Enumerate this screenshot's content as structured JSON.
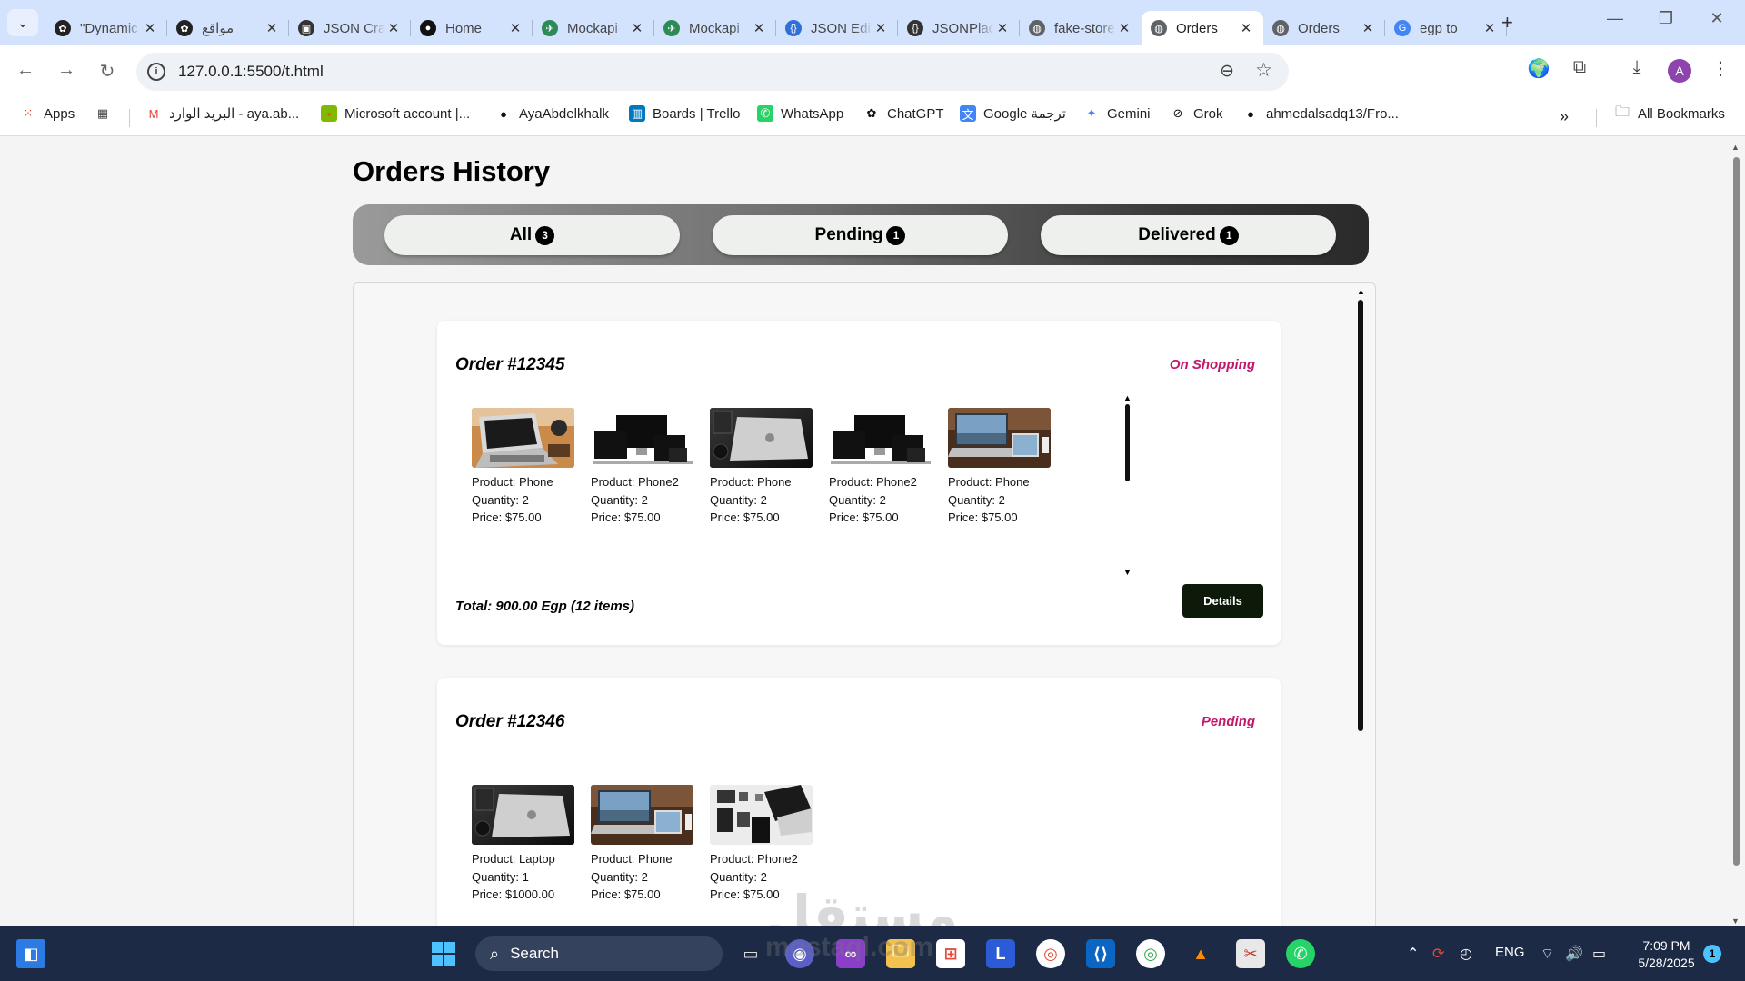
{
  "browser": {
    "tabs": [
      {
        "title": "\"Dynamic",
        "favicon": "openai-icon",
        "color": "#222222",
        "glyph": "✿"
      },
      {
        "title": "مواقع",
        "favicon": "openai-icon",
        "color": "#222222",
        "glyph": "✿"
      },
      {
        "title": "JSON Crack",
        "favicon": "json-crack-icon",
        "color": "#333333",
        "glyph": "▣"
      },
      {
        "title": "Home",
        "favicon": "github-icon",
        "color": "#111111",
        "glyph": "●"
      },
      {
        "title": "Mockapi",
        "favicon": "mockapi-icon",
        "color": "#2e8b57",
        "glyph": "✈"
      },
      {
        "title": "Mockapi",
        "favicon": "mockapi-icon",
        "color": "#2e8b57",
        "glyph": "✈"
      },
      {
        "title": "JSON Editor",
        "favicon": "json-icon",
        "color": "#2f6fd8",
        "glyph": "{}"
      },
      {
        "title": "JSONPlaceholder",
        "favicon": "jsonplaceholder-icon",
        "color": "#333333",
        "glyph": "{}"
      },
      {
        "title": "fake-store",
        "favicon": "globe-icon",
        "color": "#5f6368",
        "glyph": "◍"
      },
      {
        "title": "Orders",
        "favicon": "globe-icon",
        "color": "#5f6368",
        "glyph": "◍",
        "active": true
      },
      {
        "title": "Orders",
        "favicon": "globe-icon",
        "color": "#5f6368",
        "glyph": "◍"
      },
      {
        "title": "egp to",
        "favicon": "google-icon",
        "color": "#4285f4",
        "glyph": "G"
      }
    ],
    "url": "127.0.0.1:5500/t.html",
    "avatar_letter": "A",
    "bookmarks": [
      {
        "label": "Apps",
        "icon": "apps-grid-icon"
      },
      {
        "label": "",
        "icon": "grid-icon"
      },
      {
        "label": "البريد الوارد - aya.ab...",
        "icon": "gmail-icon"
      },
      {
        "label": "Microsoft account |...",
        "icon": "microsoft-icon"
      },
      {
        "label": "AyaAbdelkhalk",
        "icon": "github-icon"
      },
      {
        "label": "Boards | Trello",
        "icon": "trello-icon"
      },
      {
        "label": "WhatsApp",
        "icon": "whatsapp-icon"
      },
      {
        "label": "ChatGPT",
        "icon": "openai-icon"
      },
      {
        "label": "Google ترجمة",
        "icon": "google-translate-icon"
      },
      {
        "label": "Gemini",
        "icon": "gemini-icon"
      },
      {
        "label": "Grok",
        "icon": "grok-icon"
      },
      {
        "label": "ahmedalsadq13/Fro...",
        "icon": "github-icon"
      }
    ],
    "all_bookmarks": "All Bookmarks"
  },
  "page": {
    "title": "Orders History",
    "filters": [
      {
        "label": "All",
        "count": "3"
      },
      {
        "label": "Pending",
        "count": "1"
      },
      {
        "label": "Delivered",
        "count": "1"
      }
    ],
    "orders": [
      {
        "id": "Order #12345",
        "status": "On Shopping",
        "items": [
          {
            "product": "Product: Phone",
            "quantity": "Quantity: 2",
            "price": "Price: $75.00",
            "image": "laptop-desk-photo"
          },
          {
            "product": "Product: Phone2",
            "quantity": "Quantity: 2",
            "price": "Price: $75.00",
            "image": "devices-black-photo"
          },
          {
            "product": "Product: Phone",
            "quantity": "Quantity: 2",
            "price": "Price: $75.00",
            "image": "macbook-dark-photo"
          },
          {
            "product": "Product: Phone2",
            "quantity": "Quantity: 2",
            "price": "Price: $75.00",
            "image": "devices-black-photo"
          },
          {
            "product": "Product: Phone",
            "quantity": "Quantity: 2",
            "price": "Price: $75.00",
            "image": "laptop-tablet-photo"
          },
          {
            "product": "",
            "quantity": "",
            "price": "",
            "image": "flatlay-devices-photo"
          }
        ],
        "total": "Total: 900.00 Egp (12 items)",
        "details_label": "Details"
      },
      {
        "id": "Order #12346",
        "status": "Pending",
        "items": [
          {
            "product": "Product: Laptop",
            "quantity": "Quantity: 1",
            "price": "Price: $1000.00",
            "image": "macbook-dark-photo"
          },
          {
            "product": "Product: Phone",
            "quantity": "Quantity: 2",
            "price": "Price: $75.00",
            "image": "laptop-tablet-photo"
          },
          {
            "product": "Product: Phone2",
            "quantity": "Quantity: 2",
            "price": "Price: $75.00",
            "image": "flatlay-devices-photo"
          }
        ]
      }
    ],
    "watermark": "مستقل",
    "watermark_sub": "mostaql.com"
  },
  "taskbar": {
    "search_placeholder": "Search",
    "language": "ENG",
    "time": "7:09 PM",
    "date": "5/28/2025",
    "notification_count": "1"
  },
  "colors": {
    "status": "#c2186b",
    "details_button": "#0d1a0a",
    "tab_strip": "#d3e3fd",
    "taskbar": "#1c2a45"
  }
}
